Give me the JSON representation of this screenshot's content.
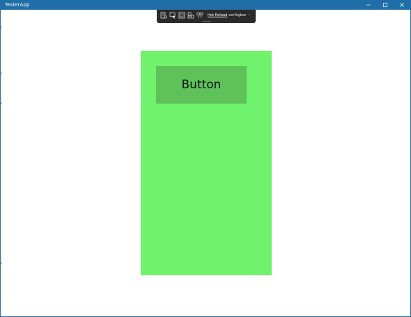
{
  "window": {
    "title": "TesterApp",
    "accent_color": "#1f6ea8"
  },
  "caption_buttons": {
    "minimize_icon": "minimize-icon",
    "maximize_icon": "maximize-icon",
    "close_icon": "close-icon"
  },
  "debug_toolbar": {
    "icons": [
      "live-visual-tree-icon",
      "select-element-icon",
      "display-layout-adorners-icon",
      "track-focus-icon",
      "binding-failures-icon"
    ],
    "hot_reload_link": "Hot Reload",
    "hot_reload_status": "verfügbar",
    "background_color": "#2a2a2a"
  },
  "content": {
    "panel_color": "#71f26c",
    "button": {
      "label": "Button",
      "background_color": "#5ec15a"
    }
  }
}
